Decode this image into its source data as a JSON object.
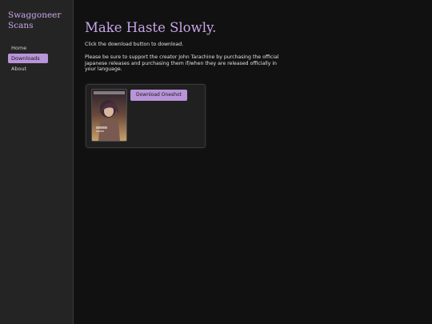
{
  "sidebar": {
    "site_title": "Swaggoneer Scans",
    "nav": [
      {
        "label": "Home",
        "active": false
      },
      {
        "label": "Downloads",
        "active": true
      },
      {
        "label": "About",
        "active": false
      }
    ]
  },
  "main": {
    "title": "Make Haste Slowly.",
    "instruction": "Click the download button to download.",
    "notice": "Please be sure to support the creator John Tarachine by purchasing the official Japanese releases and purchasing them if/when they are released officially in your language.",
    "download_label": "Download Oneshot"
  },
  "colors": {
    "accent": "#c8a6e6",
    "button": "#b894d8",
    "background": "#111111",
    "sidebar": "#242424"
  }
}
